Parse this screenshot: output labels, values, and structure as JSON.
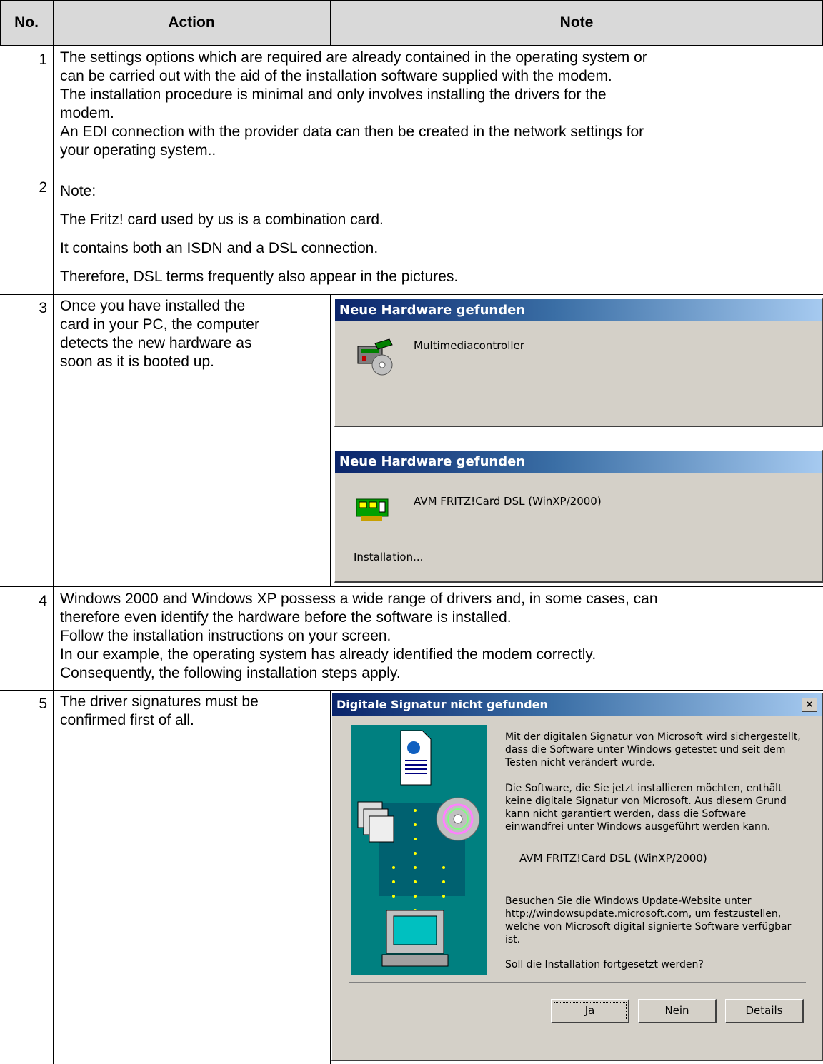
{
  "header": {
    "no": "No.",
    "action": "Action",
    "note": "Note"
  },
  "rows": [
    {
      "no": "1",
      "lines": [
        "The settings options which are required are already contained in the operating system or",
        "can be carried out with the aid of the installation software supplied with the modem.",
        "The installation procedure is minimal and only involves installing the drivers for the",
        "modem.",
        "An EDI connection with the provider data can then be created in the network settings for",
        "your operating system.."
      ]
    },
    {
      "no": "2",
      "lines": [
        "Note:",
        "The Fritz! card used by us is a combination card.",
        "It contains both an ISDN and a DSL connection.",
        "Therefore, DSL terms frequently also appear in the pictures."
      ]
    },
    {
      "no": "3",
      "lines": [
        "Once you have installed the",
        "card in your PC, the computer",
        "detects the new hardware as",
        "soon as it is booted up."
      ]
    },
    {
      "no": "4",
      "lines": [
        "Windows 2000 and Windows XP possess a wide range of drivers and, in some cases, can",
        "therefore even identify the hardware before the software is installed.",
        "Follow the installation instructions on your screen.",
        "In our example, the operating system has already identified the modem correctly.",
        "Consequently, the following installation steps apply."
      ]
    },
    {
      "no": "5",
      "lines": [
        "The driver signatures must be",
        "confirmed first of all."
      ]
    }
  ],
  "dialog1": {
    "title": "Neue Hardware gefunden",
    "device": "Multimediacontroller",
    "icon": "multimedia-controller-icon"
  },
  "dialog2": {
    "title": "Neue Hardware gefunden",
    "device": "AVM FRITZ!Card DSL (WinXP/2000)",
    "status": "Installation...",
    "icon": "network-card-icon"
  },
  "dialog3": {
    "title": "Digitale Signatur nicht gefunden",
    "close": "×",
    "para1": [
      "Mit der digitalen Signatur von Microsoft wird sichergestellt,",
      "dass die Software unter Windows getestet und seit dem",
      "Testen nicht verändert wurde."
    ],
    "para2": [
      "Die Software, die Sie jetzt installieren möchten, enthält",
      "keine digitale Signatur von Microsoft. Aus diesem Grund",
      "kann nicht garantiert werden, dass die Software",
      "einwandfrei unter Windows ausgeführt werden kann."
    ],
    "device": "AVM FRITZ!Card DSL (WinXP/2000)",
    "para3": [
      "Besuchen Sie die Windows Update-Website unter",
      "http://windowsupdate.microsoft.com, um festzustellen,",
      "welche von Microsoft digital signierte Software verfügbar",
      "ist."
    ],
    "question": "Soll die Installation fortgesetzt werden?",
    "buttons": {
      "yes": "Ja",
      "no": "Nein",
      "details": "Details"
    }
  }
}
